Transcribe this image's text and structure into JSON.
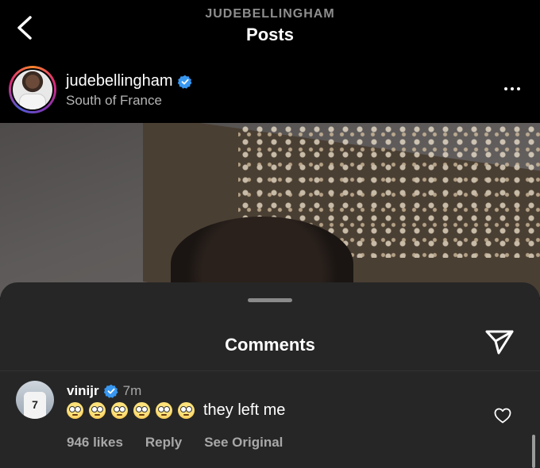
{
  "header": {
    "owner": "JUDEBELLINGHAM",
    "title": "Posts",
    "back_icon": "chevron-left-icon"
  },
  "post": {
    "username": "judebellingham",
    "location": "South of France",
    "verified": true,
    "more_icon": "more-horizontal-icon"
  },
  "comments_sheet": {
    "title": "Comments",
    "share_icon": "paper-plane-icon"
  },
  "comment": {
    "username": "vinijr",
    "verified": true,
    "time": "7m",
    "emoji_name": "face-with-rolling-eyes",
    "emoji_count": 6,
    "text": "they left me",
    "likes": "946 likes",
    "reply_label": "Reply",
    "see_original_label": "See Original",
    "avatar_number": "7",
    "like_icon": "heart-outline-icon"
  },
  "colors": {
    "background": "#000000",
    "sheet": "#262626",
    "secondary_text": "#a8a8a8",
    "verified_blue": "#3897f0"
  }
}
